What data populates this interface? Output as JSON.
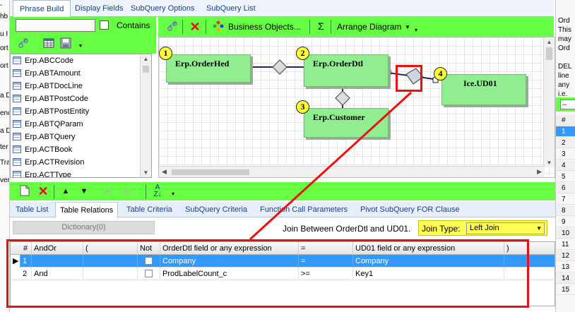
{
  "left_strip": {
    "fragments": [
      "-",
      "hb",
      "",
      "u I",
      "ort",
      "ort",
      "a D",
      "enc",
      "a D",
      "ter",
      "Tra",
      "ver"
    ]
  },
  "top_tabs": [
    {
      "label": "Phrase Build",
      "active": true
    },
    {
      "label": "Display Fields",
      "active": false
    },
    {
      "label": "SubQuery Options",
      "active": false
    },
    {
      "label": "SubQuery List",
      "active": false
    }
  ],
  "left_panel": {
    "search_value": "",
    "contains_label": "Contains",
    "tables": [
      "Erp.ABCCode",
      "Erp.ABTAmount",
      "Erp.ABTDocLine",
      "Erp.ABTPostCode",
      "Erp.ABTPostEntity",
      "Erp.ABTQParam",
      "Erp.ABTQuery",
      "Erp.ACTBook",
      "Erp.ACTRevision",
      "Erp.ACTType"
    ]
  },
  "diagram_toolbar": {
    "business_objects": "Business Objects...",
    "sigma": "Σ",
    "arrange": "Arrange Diagram"
  },
  "diagram": {
    "nodes": [
      {
        "num": "1",
        "name": "Erp.OrderHed"
      },
      {
        "num": "2",
        "name": "Erp.OrderDtl"
      },
      {
        "num": "3",
        "name": "Erp.Customer"
      },
      {
        "num": "4",
        "name": "Ice.UD01"
      }
    ]
  },
  "sub_tabs": [
    {
      "label": "Table List",
      "active": false
    },
    {
      "label": "Table Relations",
      "active": true
    },
    {
      "label": "Table Criteria",
      "active": false
    },
    {
      "label": "SubQuery Criteria",
      "active": false
    },
    {
      "label": "Function Call Parameters",
      "active": false
    },
    {
      "label": "Pivot SubQuery FOR Clause",
      "active": false
    }
  ],
  "relations": {
    "dictionary_button": "Dictionary(0)",
    "join_between": "Join Between OrderDtl and UD01.",
    "join_type_label": "Join Type:",
    "join_type_value": "Left Join",
    "columns": [
      "#",
      "AndOr",
      "(",
      "Not",
      "OrderDtl field or any expression",
      "=",
      "UD01 field or any expression",
      ")"
    ],
    "rows": [
      {
        "num": "1",
        "andor": "",
        "paren_open": "",
        "not": false,
        "left": "Company",
        "op": "=",
        "right": "Company",
        "paren_close": "",
        "selected": true
      },
      {
        "num": "2",
        "andor": "And",
        "paren_open": "",
        "not": false,
        "left": "ProdLabelCount_c",
        "op": ">=",
        "right": "Key1",
        "paren_close": "",
        "selected": false
      }
    ]
  },
  "right_panel": {
    "lines": [
      "Ord",
      "This",
      "may",
      "Ord",
      "",
      "DEL",
      "line",
      "any",
      "i.e."
    ],
    "numbers": [
      "#",
      "1",
      "2",
      "3",
      "4",
      "5",
      "6",
      "7",
      "8",
      "9",
      "10",
      "11",
      "12",
      "13",
      "14",
      "15"
    ]
  },
  "colors": {
    "toolbar_green": "#66ff44",
    "node_green": "#90ee90",
    "badge_yellow": "#ffff33",
    "annotation_red": "#e8110e",
    "selection_blue": "#3399ff"
  }
}
